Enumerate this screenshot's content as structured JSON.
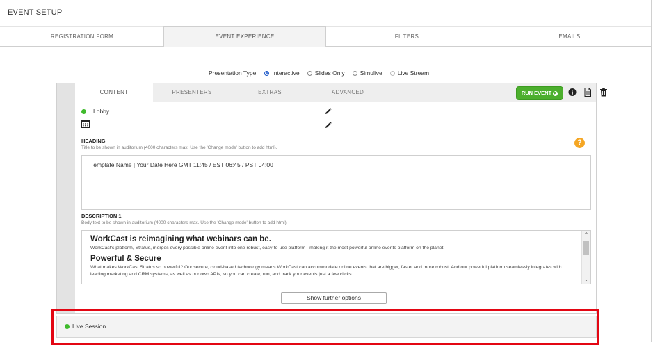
{
  "page": {
    "title": "EVENT SETUP"
  },
  "tabs": [
    "REGISTRATION FORM",
    "EVENT EXPERIENCE",
    "FILTERS",
    "EMAILS"
  ],
  "presentation_type": {
    "label": "Presentation Type",
    "options": [
      "Interactive",
      "Slides Only",
      "Simulive",
      "Live Stream"
    ],
    "selected": "Interactive"
  },
  "subtabs": [
    "CONTENT",
    "PRESENTERS",
    "EXTRAS",
    "ADVANCED"
  ],
  "run_event_label": "RUN EVENT",
  "lobby": {
    "label": "Lobby",
    "status_color": "#3fba2c"
  },
  "heading_section": {
    "title": "HEADING",
    "hint": "Title to be shown in auditorium (4000 characters max. Use the 'Change mode' button to add html).",
    "value": "Template Name | Your Date Here GMT 11:45 / EST 06:45 / PST 04:00"
  },
  "description_section": {
    "title": "DESCRIPTION 1",
    "hint": "Body text to be shown in auditorium (4000 characters max. Use the 'Change mode' button to add html).",
    "h1": "WorkCast is reimagining what webinars can be.",
    "p1": "WorkCast's platform, Stratus, merges every possible online event into one robust, easy-to-use platform - making it the most powerful online events platform on the planet.",
    "h2": "Powerful & Secure",
    "p2": "What makes WorkCast Stratus so powerful? Our secure, cloud-based technology means WorkCast can accommodate online events that are bigger, faster and more robust. And our powerful platform seamlessly integrates with leading marketing and CRM systems, as well as our own APIs, so you can create, run, and track your events just a few clicks."
  },
  "further_options_label": "Show further options",
  "live_session": {
    "label": "Live Session",
    "status_color": "#3fba2c"
  },
  "highlight_color": "#e30613",
  "accent_green": "#4caf2d",
  "help_color": "#f5a623"
}
